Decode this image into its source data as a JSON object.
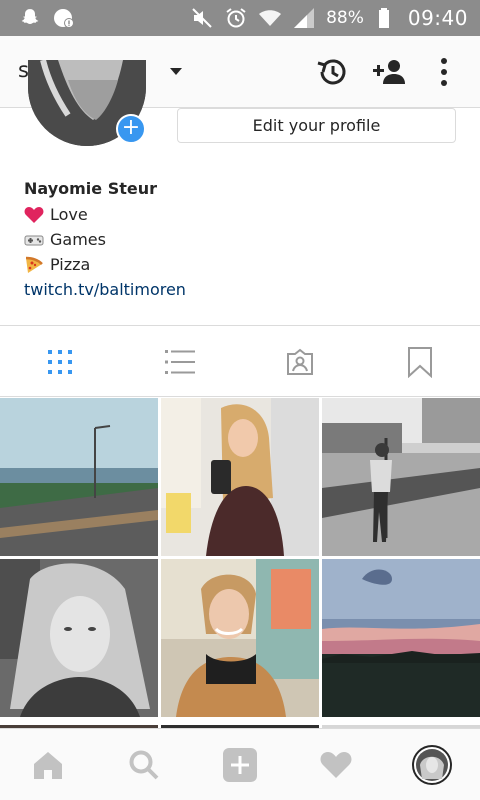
{
  "status_bar": {
    "battery_percent": "88%",
    "clock": "09:40",
    "icons": [
      "snapchat-icon",
      "notification-icon",
      "mute-icon",
      "alarm-icon",
      "wifi-icon",
      "signal-icon",
      "battery-icon"
    ]
  },
  "header": {
    "username": "steurterreur",
    "icons": [
      "chevron-down-icon",
      "history-icon",
      "add-user-icon",
      "more-vert-icon"
    ]
  },
  "profile": {
    "edit_label": "Edit your profile",
    "name": "Nayomie Steur",
    "bio_lines": [
      {
        "icon": "heart-emoji",
        "text": "Love"
      },
      {
        "icon": "gamepad-emoji",
        "text": "Games"
      },
      {
        "icon": "pizza-emoji",
        "text": "Pizza"
      }
    ],
    "link": "twitch.tv/baltimoren"
  },
  "tabs": {
    "items": [
      "grid-view",
      "list-view",
      "tagged",
      "saved"
    ],
    "active": "grid-view",
    "active_color": "#3897f0"
  },
  "grid": {
    "photos": [
      "road-landscape-photo",
      "mirror-selfie-photo",
      "street-pose-photo",
      "portrait-bw-photo",
      "smiling-selfie-photo",
      "sunset-sky-photo"
    ]
  },
  "bottom_nav": {
    "items": [
      "home",
      "search",
      "add",
      "activity",
      "profile"
    ]
  },
  "colors": {
    "status_bar": "#8c8c8c",
    "accent": "#3897f0",
    "link": "#003569"
  }
}
